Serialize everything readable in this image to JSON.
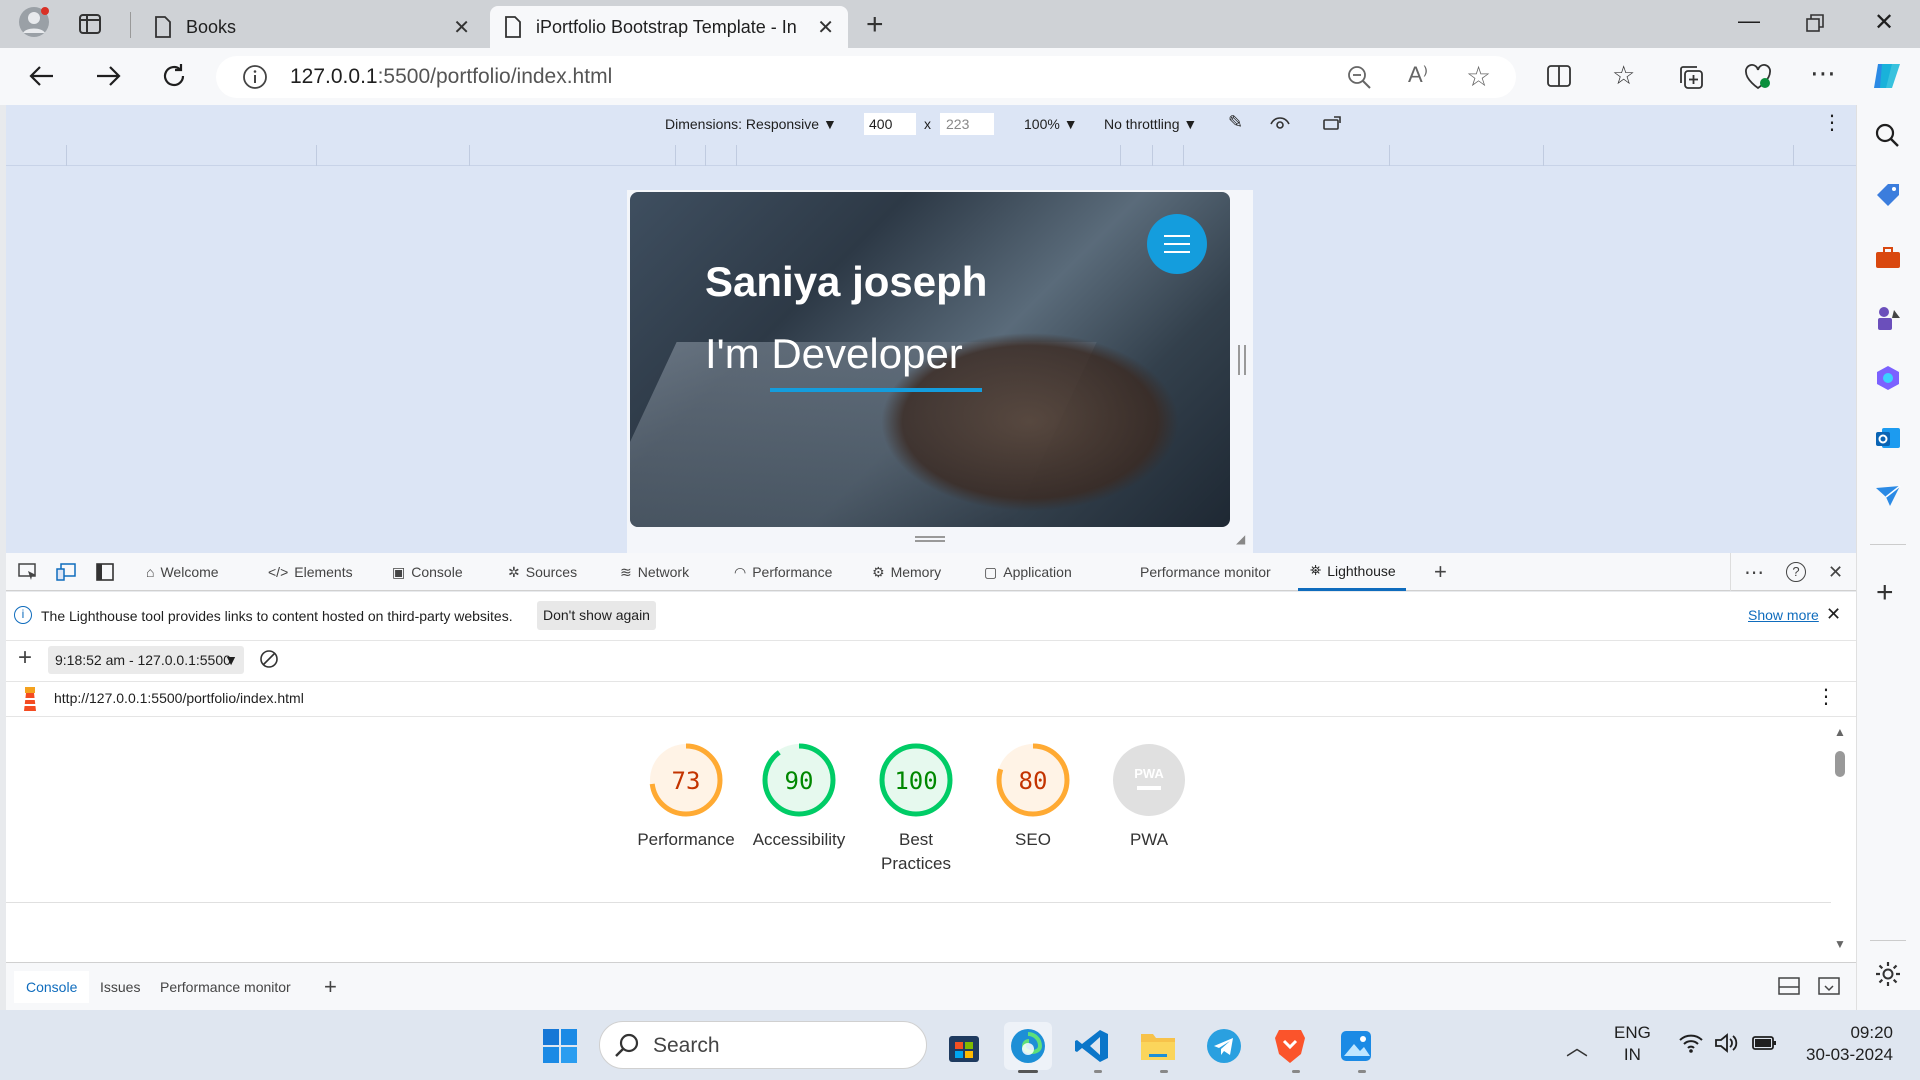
{
  "browser": {
    "tabs": [
      {
        "title": "Books"
      },
      {
        "title": "iPortfolio Bootstrap Template - Index"
      }
    ],
    "address": {
      "host": "127.0.0.1",
      "rest": ":5500/portfolio/index.html"
    }
  },
  "device_toolbar": {
    "dimensions": "Dimensions: Responsive",
    "width": "400",
    "height_placeholder": "223",
    "times": "x",
    "zoom": "100%",
    "throttling": "No throttling"
  },
  "page": {
    "name": "Saniya joseph",
    "role": "I'm Developer"
  },
  "devtools": {
    "tabs": [
      "Welcome",
      "Elements",
      "Console",
      "Sources",
      "Network",
      "Performance",
      "Memory",
      "Application",
      "Performance monitor",
      "Lighthouse"
    ],
    "info_message": "The Lighthouse tool provides links to content hosted on third-party websites.",
    "dont_show": "Don't show again",
    "show_more": "Show more",
    "report_select": "9:18:52 am - 127.0.0.1:5500",
    "report_url": "http://127.0.0.1:5500/portfolio/index.html",
    "scores": [
      {
        "label": "Performance",
        "score": "73",
        "value": 73,
        "color": "#fa3",
        "text_color": "#c33300",
        "bg": "#fff3e6"
      },
      {
        "label": "Accessibility",
        "score": "90",
        "value": 90,
        "color": "#0c6",
        "text_color": "#008800",
        "bg": "#e6f9ee"
      },
      {
        "label": "Best Practices",
        "score": "100",
        "value": 100,
        "color": "#0c6",
        "text_color": "#008800",
        "bg": "#e6f9ee"
      },
      {
        "label": "SEO",
        "score": "80",
        "value": 80,
        "color": "#fa3",
        "text_color": "#c33300",
        "bg": "#fff3e6"
      },
      {
        "label": "PWA",
        "score": "PWA",
        "value": 0,
        "color": "#e0e0e0",
        "text_color": "#fff",
        "bg": "#e0e0e0"
      }
    ],
    "drawer_tabs": [
      "Console",
      "Issues",
      "Performance monitor"
    ]
  },
  "taskbar": {
    "search_placeholder": "Search",
    "lang_top": "ENG",
    "lang_bottom": "IN",
    "time": "09:20",
    "date": "30-03-2024"
  }
}
